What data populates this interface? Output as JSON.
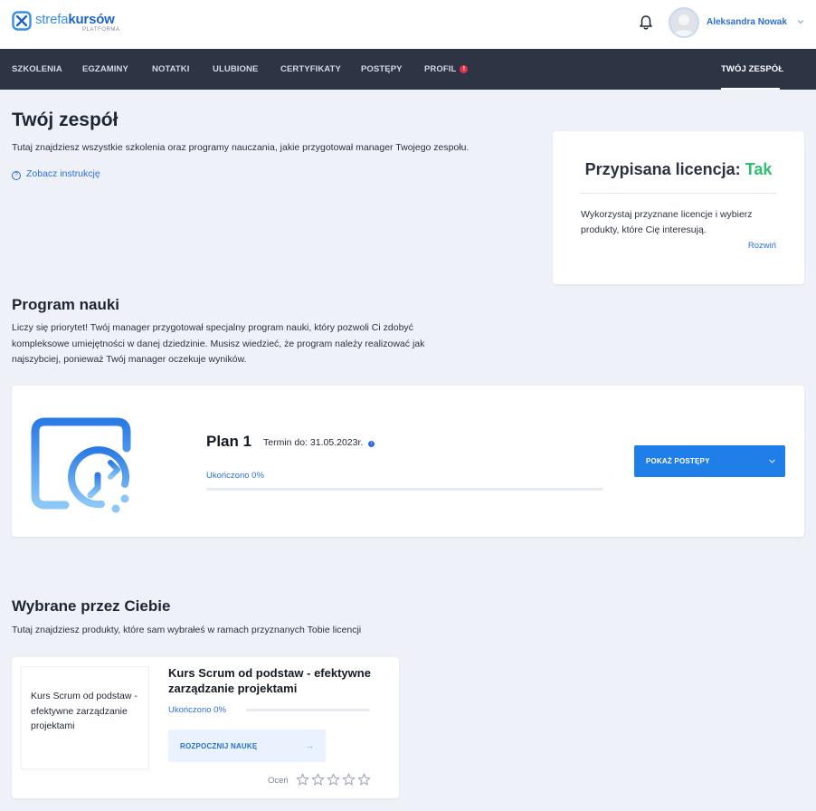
{
  "header": {
    "logo_word1": "strefa",
    "logo_word2": "kursów",
    "logo_sub": "PLATFORMA",
    "user_name": "Aleksandra Nowak"
  },
  "nav": {
    "items": [
      "SZKOLENIA",
      "EGZAMINY",
      "NOTATKI",
      "ULUBIONE",
      "CERTYFIKATY",
      "POSTĘPY",
      "PROFIL"
    ],
    "profile_alert": "!",
    "active": "TWÓJ ZESPÓŁ"
  },
  "page": {
    "title": "Twój zespół",
    "intro": "Tutaj znajdziesz wszystkie szkolenia oraz programy nauczania, jakie przygotował manager Twojego zespołu.",
    "help_link": "Zobacz instrukcję"
  },
  "license": {
    "title": "Przypisana licencja:",
    "value": "Tak",
    "description": "Wykorzystaj przyznane licencje i wybierz produkty, które Cię interesują.",
    "expand": "Rozwiń"
  },
  "program": {
    "title": "Program nauki",
    "description": "Liczy się priorytet! Twój manager przygotował specjalny program nauki, który pozwoli Ci zdobyć kompleksowe umiejętności w danej dziedzinie. Musisz wiedzieć, że program należy realizować jak najszybciej, ponieważ Twój manager oczekuje wyników.",
    "plan": {
      "name": "Plan 1",
      "deadline": "Termin do: 31.05.2023r.",
      "progress_label": "Ukończono 0%",
      "progress": 0,
      "button": "POKAŻ POSTĘPY"
    }
  },
  "picked": {
    "title": "Wybrane przez Ciebie",
    "description": "Tutaj znajdziesz produkty, które sam wybrałeś w ramach przyznanych Tobie licencji",
    "course": {
      "thumb_text": "Kurs Scrum od podstaw - efektywne zarządzanie projektami",
      "title": "Kurs Scrum od podstaw - efektywne zarządzanie projektami",
      "progress_label": "Ukończono 0%",
      "progress": 0,
      "button": "ROZPOCZNIJ NAUKĘ",
      "rate_label": "Oceń",
      "rating": 0,
      "max_rating": 5
    }
  },
  "colors": {
    "accent": "#1f7ee8",
    "nav_bg": "#2d3444",
    "license_yes": "#2fbf71",
    "alert": "#e0314b"
  }
}
